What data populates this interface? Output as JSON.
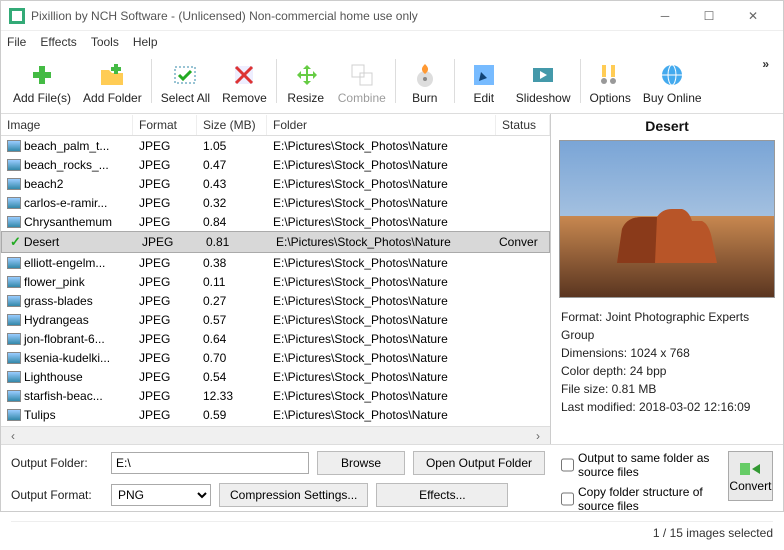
{
  "window": {
    "title": "Pixillion by NCH Software - (Unlicensed) Non-commercial home use only"
  },
  "menu": {
    "file": "File",
    "effects": "Effects",
    "tools": "Tools",
    "help": "Help"
  },
  "toolbar": {
    "addfiles": "Add File(s)",
    "addfolder": "Add Folder",
    "selectall": "Select All",
    "remove": "Remove",
    "resize": "Resize",
    "combine": "Combine",
    "burn": "Burn",
    "edit": "Edit",
    "slideshow": "Slideshow",
    "options": "Options",
    "buyonline": "Buy Online"
  },
  "columns": {
    "image": "Image",
    "format": "Format",
    "size": "Size (MB)",
    "folder": "Folder",
    "status": "Status"
  },
  "folder_path": "E:\\Pictures\\Stock_Photos\\Nature",
  "files": [
    {
      "name": "beach_palm_t...",
      "fmt": "JPEG",
      "size": "1.05"
    },
    {
      "name": "beach_rocks_...",
      "fmt": "JPEG",
      "size": "0.47"
    },
    {
      "name": "beach2",
      "fmt": "JPEG",
      "size": "0.43"
    },
    {
      "name": "carlos-e-ramir...",
      "fmt": "JPEG",
      "size": "0.32"
    },
    {
      "name": "Chrysanthemum",
      "fmt": "JPEG",
      "size": "0.84"
    },
    {
      "name": "Desert",
      "fmt": "JPEG",
      "size": "0.81",
      "sel": true,
      "status": "Conver"
    },
    {
      "name": "elliott-engelm...",
      "fmt": "JPEG",
      "size": "0.38"
    },
    {
      "name": "flower_pink",
      "fmt": "JPEG",
      "size": "0.11"
    },
    {
      "name": "grass-blades",
      "fmt": "JPEG",
      "size": "0.27"
    },
    {
      "name": "Hydrangeas",
      "fmt": "JPEG",
      "size": "0.57"
    },
    {
      "name": "jon-flobrant-6...",
      "fmt": "JPEG",
      "size": "0.64"
    },
    {
      "name": "ksenia-kudelki...",
      "fmt": "JPEG",
      "size": "0.70"
    },
    {
      "name": "Lighthouse",
      "fmt": "JPEG",
      "size": "0.54"
    },
    {
      "name": "starfish-beac...",
      "fmt": "JPEG",
      "size": "12.33"
    },
    {
      "name": "Tulips",
      "fmt": "JPEG",
      "size": "0.59"
    }
  ],
  "preview": {
    "title": "Desert",
    "format": "Format: Joint Photographic Experts Group",
    "dims": "Dimensions: 1024 x 768",
    "depth": "Color depth: 24 bpp",
    "fsize": "File size: 0.81 MB",
    "modified": "Last modified: 2018-03-02 12:16:09"
  },
  "output": {
    "folder_lbl": "Output Folder:",
    "folder_val": "E:\\",
    "format_lbl": "Output Format:",
    "format_val": "PNG",
    "browse": "Browse",
    "open": "Open Output Folder",
    "compression": "Compression Settings...",
    "effects": "Effects...",
    "same_folder": "Output to same folder as source files",
    "copy_struct": "Copy folder structure of source files",
    "convert": "Convert"
  },
  "status": "1 / 15 images selected"
}
